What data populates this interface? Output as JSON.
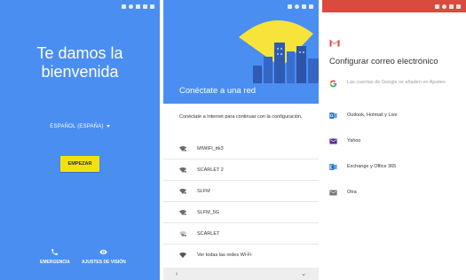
{
  "welcome_screen": {
    "title": "Te damos la bienvenida",
    "language": "ESPAÑOL (ESPAÑA)",
    "start_button": "EMPEZAR",
    "emergency": "EMERGENCIA",
    "vision_settings": "AJUSTES DE VISIÓN",
    "background_color": "#4a8ef2",
    "start_button_color": "#f3e10f"
  },
  "network_screen": {
    "title": "Conéctate a una red",
    "description": "Conéctate a Internet para continuar con la configuración.",
    "networks": [
      {
        "name": "MIWIFI_ttk3",
        "icon": "wifi-locked-icon"
      },
      {
        "name": "SCARLET 2",
        "icon": "wifi-locked-icon"
      },
      {
        "name": "SLFM",
        "icon": "wifi-locked-icon"
      },
      {
        "name": "SLFM_5G",
        "icon": "wifi-locked-icon"
      },
      {
        "name": "SCARLET",
        "icon": "wifi-weak-locked-icon"
      },
      {
        "name": "Ver todas las redes Wi-Fi",
        "icon": "wifi-icon"
      }
    ],
    "nav_back": "‹",
    "nav_more": "⌄"
  },
  "email_screen": {
    "title": "Configurar correo electrónico",
    "accounts": [
      {
        "label": "Las cuentas de Google se añaden en Ajustes",
        "icon": "google-icon"
      },
      {
        "label": "Outlook, Hotmail y Live",
        "icon": "outlook-icon"
      },
      {
        "label": "Yahoo",
        "icon": "yahoo-icon"
      },
      {
        "label": "Exchange y Office 365",
        "icon": "exchange-icon"
      },
      {
        "label": "Otra",
        "icon": "mail-icon"
      }
    ],
    "header_color": "#d94c3d"
  }
}
